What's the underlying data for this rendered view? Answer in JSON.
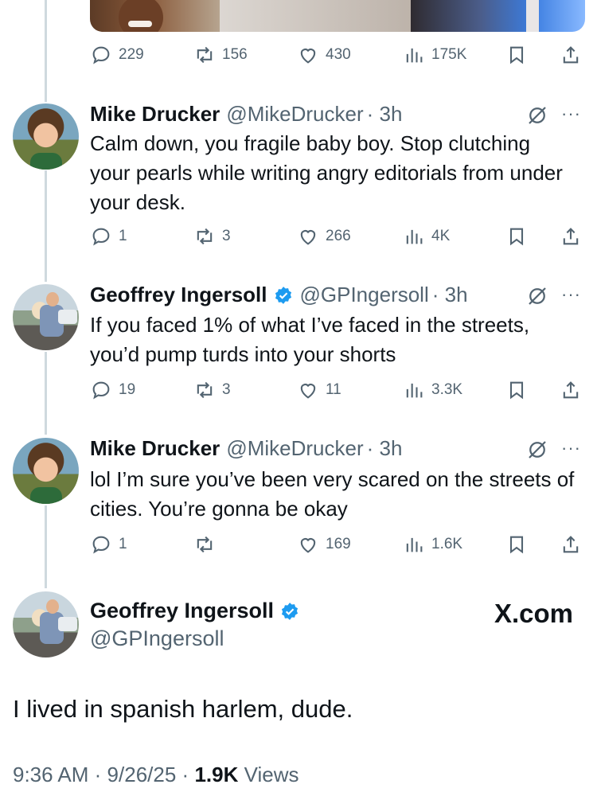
{
  "colors": {
    "text": "#0f1419",
    "muted": "#536471",
    "verified": "#1d9bf0",
    "thread": "#cfd9de"
  },
  "icons": {
    "reply": "reply-icon",
    "retweet": "retweet-icon",
    "like": "like-icon",
    "views": "views-icon",
    "bookmark": "bookmark-icon",
    "share": "share-icon",
    "muted": "muted-icon",
    "more": "more-icon",
    "verified": "verified-badge-icon"
  },
  "top_post": {
    "replies": "229",
    "reposts": "156",
    "likes": "430",
    "views": "175K"
  },
  "replies": [
    {
      "name": "Mike Drucker",
      "handle": "@MikeDrucker",
      "time": "· 3h",
      "text": "Calm down, you fragile baby boy. Stop clutching your pearls while writing angry editorials from under your desk.",
      "replies": "1",
      "reposts": "3",
      "likes": "266",
      "views": "4K"
    },
    {
      "name": "Geoffrey Ingersoll",
      "handle": "@GPIngersoll",
      "time": "· 3h",
      "text": "If you faced 1% of what I’ve faced in the streets, you’d pump turds into your shorts",
      "replies": "19",
      "reposts": "3",
      "likes": "11",
      "views": "3.3K"
    },
    {
      "name": "Mike Drucker",
      "handle": "@MikeDrucker",
      "time": "· 3h",
      "text": "lol I’m sure you’ve been very scared on the streets of cities. You’re gonna be okay",
      "replies": "1",
      "reposts": "",
      "likes": "169",
      "views": "1.6K"
    }
  ],
  "main_post": {
    "name": "Geoffrey Ingersoll",
    "handle": "@GPIngersoll",
    "site": "X.com",
    "text": "I lived in spanish harlem, dude.",
    "time": "9:36 AM",
    "date": "9/26/25",
    "views_count": "1.9K",
    "views_label": "Views",
    "sep": "·"
  }
}
